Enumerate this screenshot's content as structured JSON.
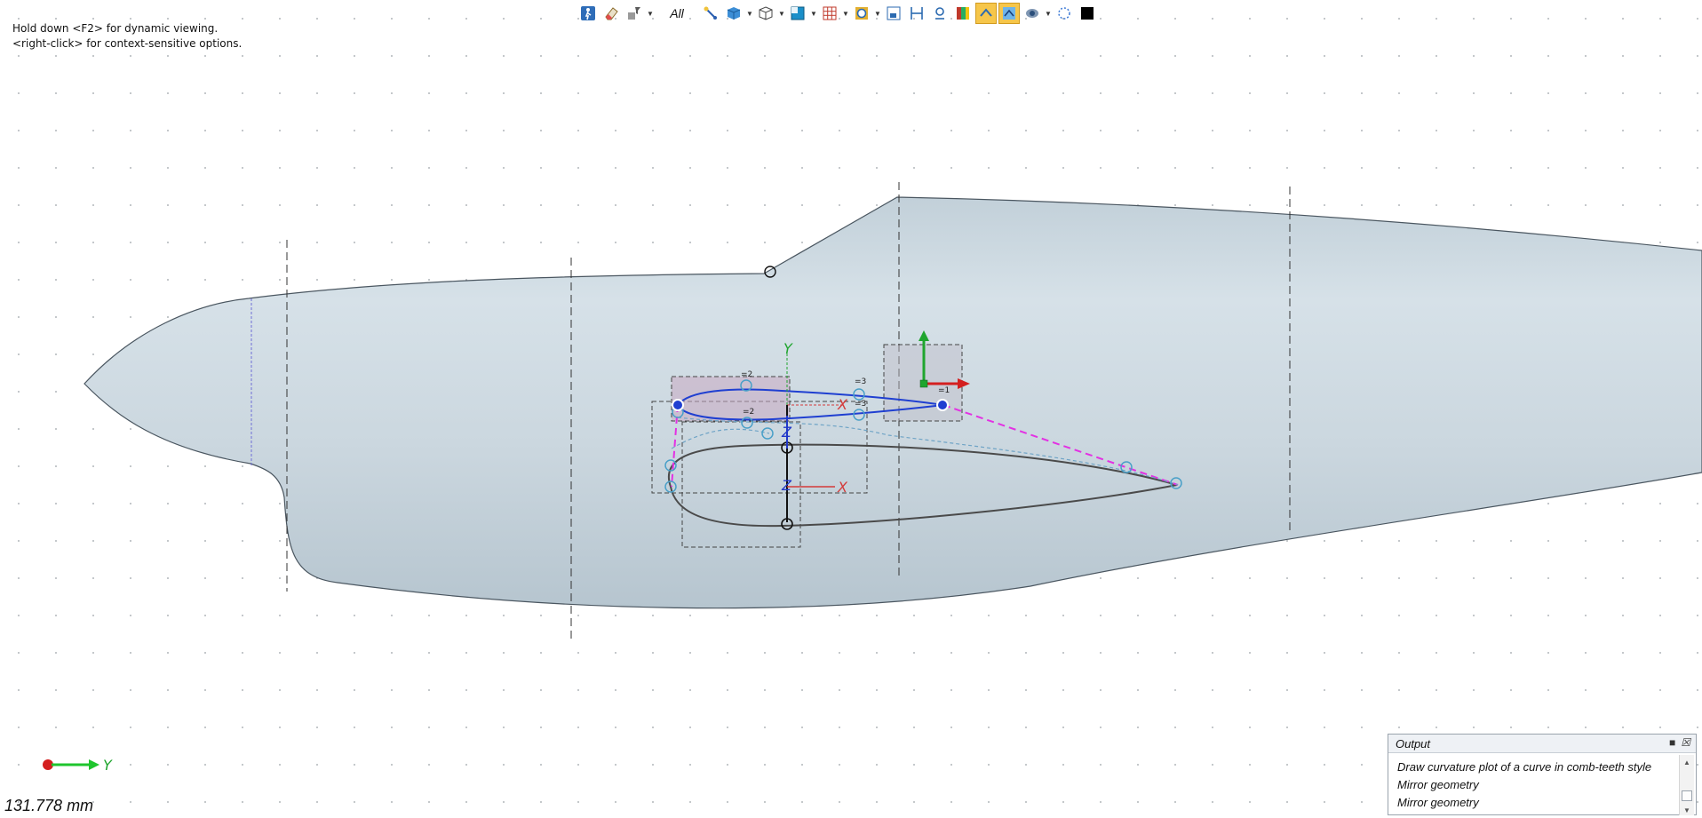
{
  "hints": {
    "line1": "Hold down <F2> for dynamic viewing.",
    "line2": "<right-click> for context-sensitive options."
  },
  "toolbar": {
    "filter_label": "All",
    "active_color": "#f6c64a",
    "icons": [
      "walk-icon",
      "eraser-icon",
      "selection-filter-icon",
      "cursor-pick-icon",
      "shaded-view-icon",
      "wireframe-view-icon",
      "display-mode-icon",
      "grid-icon",
      "circle-target-icon",
      "frame-icon",
      "dimension-icon",
      "pin-icon",
      "color-palette-icon",
      "snap-icon",
      "sketch-mode-icon",
      "render-icon",
      "dotted-circle-icon",
      "black-square-icon"
    ]
  },
  "viewport": {
    "sketch_labels": {
      "y_axis": "Y",
      "x_axis": "X",
      "z_axis": "Z",
      "x_axis_2": "X",
      "z_axis_2": "Z",
      "constraint_1": "=2",
      "constraint_2": "=3",
      "constraint_3": "=2",
      "constraint_4": "=3",
      "constraint_5": "=1"
    },
    "body_color": "#c9d6de",
    "sketch_color": "#1f3fd1",
    "dashed_guide_color": "#e331e3"
  },
  "triad": {
    "axis_label": "Y"
  },
  "measurement": "131.778 mm",
  "output": {
    "title": "Output",
    "lines": [
      "Draw curvature plot of a curve in comb-teeth style",
      "Mirror geometry",
      "Mirror geometry"
    ]
  }
}
